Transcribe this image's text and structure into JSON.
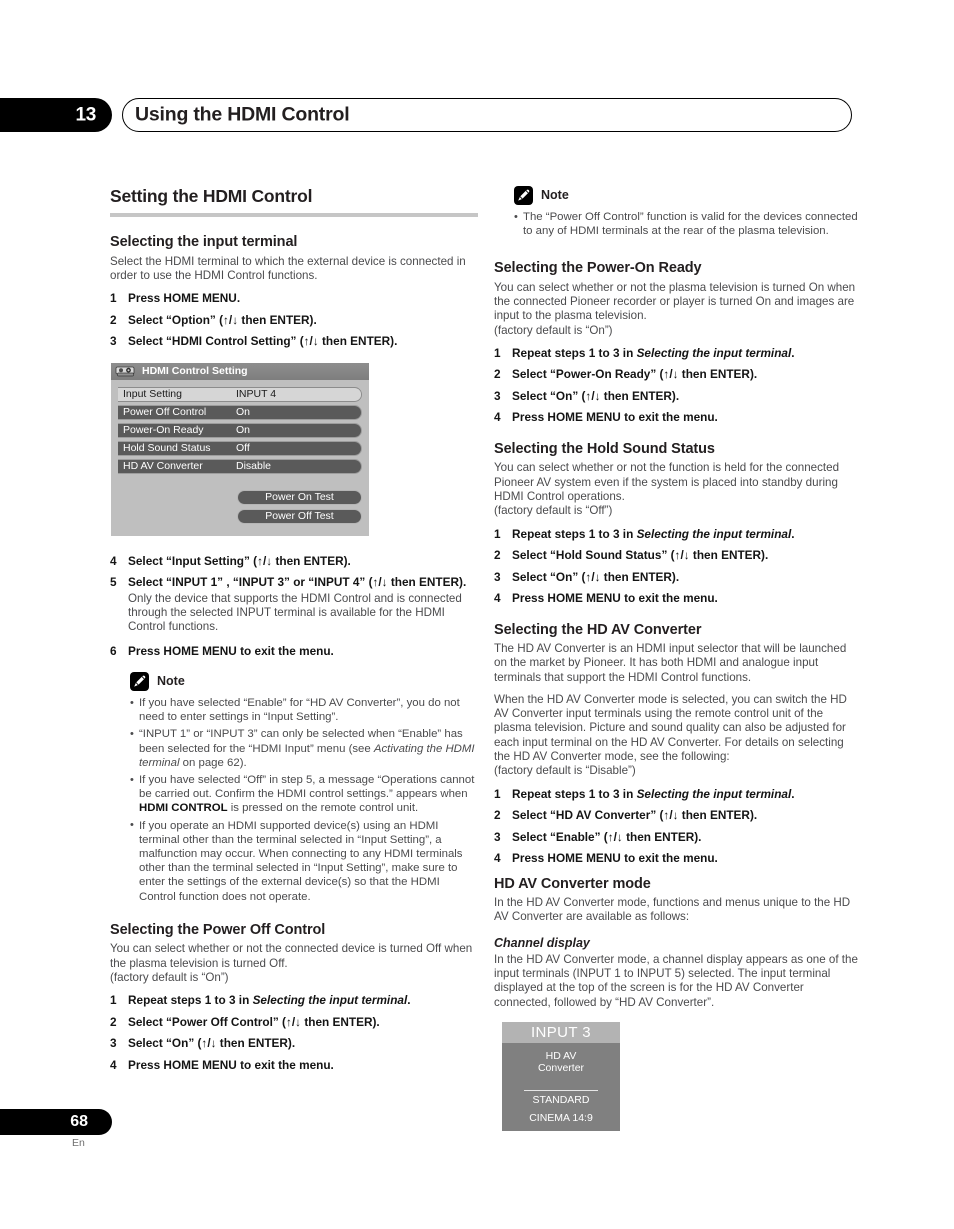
{
  "header": {
    "chapter_number": "13",
    "title": "Using the HDMI Control",
    "chapter_icon": "chapter-number-badge"
  },
  "footer": {
    "page_number": "68",
    "language": "En"
  },
  "left_column": {
    "section_title": "Setting the HDMI Control",
    "input_terminal": {
      "heading": "Selecting the input terminal",
      "intro": "Select the HDMI terminal to which the external device is connected in order to use the HDMI Control functions.",
      "steps_1_3": [
        {
          "num": "1",
          "text": "Press HOME MENU."
        },
        {
          "num": "2",
          "text": "Select “Option” (↑/↓ then ENTER)."
        },
        {
          "num": "3",
          "text": "Select “HDMI Control Setting” (↑/↓ then ENTER)."
        }
      ],
      "steps_4_6": [
        {
          "num": "4",
          "text": "Select “Input Setting” (↑/↓ then ENTER)."
        },
        {
          "num": "5",
          "text": "Select “INPUT 1” , “INPUT 3” or “INPUT 4” (↑/↓ then ENTER)."
        },
        {
          "num": "6",
          "text": "Press HOME MENU to exit the menu."
        }
      ],
      "step5_note": "Only the device that supports the HDMI Control and is connected through the selected INPUT terminal is available for the HDMI Control functions."
    },
    "osd": {
      "title": "HDMI Control Setting",
      "title_icon": "hdmi-device-icon",
      "rows": [
        {
          "label": "Input Setting",
          "value": "INPUT 4",
          "selected": true
        },
        {
          "label": "Power Off Control",
          "value": "On",
          "selected": false
        },
        {
          "label": "Power-On Ready",
          "value": "On",
          "selected": false
        },
        {
          "label": "Hold Sound Status",
          "value": "Off",
          "selected": false
        },
        {
          "label": "HD AV Converter",
          "value": "Disable",
          "selected": false
        }
      ],
      "buttons": [
        {
          "label": "Power On Test"
        },
        {
          "label": "Power Off Test"
        }
      ]
    },
    "note": {
      "label": "Note",
      "icon": "pencil-note-icon",
      "items": [
        "If you have selected “Enable” for “HD AV Converter”, you do not need to enter settings in “Input Setting”.",
        "“INPUT 1” or “INPUT 3” can only be selected when “Enable” has been selected for the “HDMI Input” menu (see Activating the HDMI terminal on page 62).",
        "If you have selected “Off” in step 5, a message “Operations cannot be carried out. Confirm the HDMI control settings.” appears when HDMI CONTROL is pressed on the remote control unit.",
        "If you operate an HDMI supported device(s) using an HDMI terminal other than the terminal selected in “Input Setting”, a malfunction may occur. When connecting to any HDMI terminals other than the terminal selected in “Input Setting”, make sure to enter the settings of the external device(s) so that the HDMI Control function does not operate."
      ]
    },
    "power_off_control": {
      "heading": "Selecting the Power Off Control",
      "intro": "You can select whether or not the connected device is turned Off when the plasma television is turned Off.",
      "default": "(factory default is “On”)",
      "steps": [
        {
          "num": "1",
          "text": "Repeat steps 1 to 3 in Selecting the input terminal."
        },
        {
          "num": "2",
          "text": "Select “Power Off Control” (↑/↓ then ENTER)."
        },
        {
          "num": "3",
          "text": "Select “On” (↑/↓ then ENTER)."
        },
        {
          "num": "4",
          "text": "Press HOME MENU to exit the menu."
        }
      ]
    }
  },
  "right_column": {
    "note": {
      "label": "Note",
      "icon": "pencil-note-icon",
      "items": [
        "The “Power Off Control” function is valid for the devices connected to any of HDMI terminals at the rear of the plasma television."
      ]
    },
    "power_on_ready": {
      "heading": "Selecting the Power-On Ready",
      "intro": "You can select whether or not the plasma television is turned On when the connected Pioneer recorder or player is turned On and images are input to the plasma television.",
      "default": "(factory default is “On”)",
      "steps": [
        {
          "num": "1",
          "text": "Repeat steps 1 to 3 in Selecting the input terminal."
        },
        {
          "num": "2",
          "text": "Select “Power-On Ready” (↑/↓ then ENTER)."
        },
        {
          "num": "3",
          "text": "Select “On” (↑/↓ then ENTER)."
        },
        {
          "num": "4",
          "text": "Press HOME MENU to exit the menu."
        }
      ]
    },
    "hold_sound_status": {
      "heading": "Selecting the Hold Sound Status",
      "intro": "You can select whether or not the function is held for the connected Pioneer AV system even if the system is placed into standby during HDMI Control operations.",
      "default": "(factory default is “Off”)",
      "steps": [
        {
          "num": "1",
          "text": "Repeat steps 1 to 3 in Selecting the input terminal."
        },
        {
          "num": "2",
          "text": "Select “Hold Sound Status” (↑/↓ then ENTER)."
        },
        {
          "num": "3",
          "text": "Select “On” (↑/↓ then ENTER)."
        },
        {
          "num": "4",
          "text": "Press HOME MENU to exit the menu."
        }
      ]
    },
    "hd_av_converter": {
      "heading": "Selecting the HD AV Converter",
      "para1": "The HD AV Converter is an HDMI input selector that will be launched on the market by Pioneer. It has both HDMI and analogue input terminals that support the HDMI Control functions.",
      "para2": "When the HD AV Converter mode is selected, you can switch the HD AV Converter input terminals using the remote control unit of the plasma television. Picture and sound quality can also be adjusted for each input terminal on the HD AV Converter. For details on selecting the HD AV Converter mode, see the following:",
      "default": "(factory default is “Disable”)",
      "steps": [
        {
          "num": "1",
          "text": "Repeat steps 1 to 3 in Selecting the input terminal."
        },
        {
          "num": "2",
          "text": "Select “HD AV Converter” (↑/↓ then ENTER)."
        },
        {
          "num": "3",
          "text": "Select “Enable” (↑/↓ then ENTER)."
        },
        {
          "num": "4",
          "text": "Press HOME MENU to exit the menu."
        }
      ]
    },
    "hd_av_converter_mode": {
      "heading": "HD AV Converter mode",
      "intro": "In the HD AV Converter mode, functions and menus unique to the HD AV Converter are available as follows:",
      "channel_display": {
        "heading": "Channel display",
        "body": "In the HD AV Converter mode, a channel display appears as one of the input terminals (INPUT 1 to INPUT 5) selected. The input terminal displayed at the top of the screen is for the HD AV Converter connected, followed by “HD AV Converter”."
      },
      "osd_display": {
        "input_label": "INPUT 3",
        "device_line1": "HD AV",
        "device_line2": "Converter",
        "mode_line1": "STANDARD",
        "mode_line2": "CINEMA 14:9"
      }
    }
  },
  "colors": {
    "accent_black": "#000000",
    "rule_gray": "#c6c6c6",
    "body_gray": "#4b4b4d",
    "osd_panel": "#bfbfbf",
    "osd_row_normal": "#5a5a5a",
    "osd_row_selected": "#d6d6d6"
  }
}
